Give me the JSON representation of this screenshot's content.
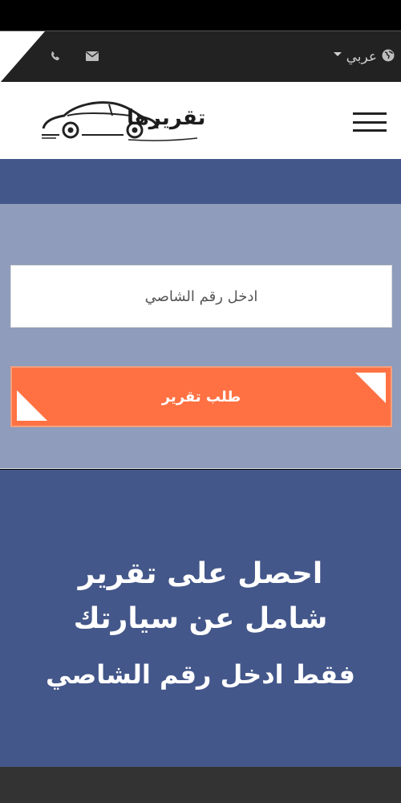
{
  "topbar": {
    "language": "عربي",
    "icons": [
      "phone-icon",
      "mail-icon",
      "globe-icon"
    ]
  },
  "header": {
    "logo_text": "تقريرها"
  },
  "form": {
    "vin_placeholder": "ادخل رقم الشاصي",
    "submit_label": "طلب تقرير"
  },
  "hero": {
    "headline_line1": "احصل على تقرير",
    "headline_line2": "شامل عن سيارتك",
    "subheadline": "فقط ادخل رقم الشاصي"
  },
  "colors": {
    "topbar_bg": "#222222",
    "band_bg": "#44578a",
    "form_bg": "#8f9cbb",
    "accent": "#ff7143"
  }
}
